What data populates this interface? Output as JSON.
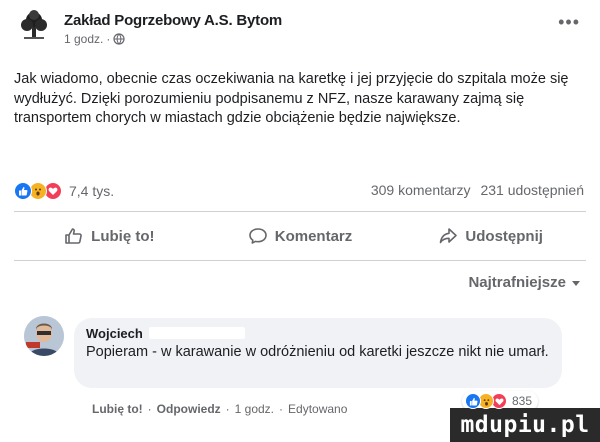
{
  "post": {
    "page_name": "Zakład Pogrzebowy A.S. Bytom",
    "time": "1 godz.",
    "separator": "·",
    "text": "Jak wiadomo, obecnie czas oczekiwania na karetkę i jej przyjęcie do szpitala może się wydłużyć. Dzięki porozumieniu podpisanemu z NFZ, nasze karawany zajmą się transportem chorych w miastach gdzie obciążenie będzie największe.",
    "more_icon": "more-horizontal-icon",
    "privacy_icon": "globe-icon"
  },
  "stats": {
    "reactions": "7,4 tys.",
    "comments": "309 komentarzy",
    "shares": "231 udostępnień",
    "reaction_icons": [
      "like-icon",
      "wow-icon",
      "love-icon"
    ]
  },
  "actions": {
    "like": "Lubię to!",
    "comment": "Komentarz",
    "share": "Udostępnij"
  },
  "comments_sort": "Najtrafniejsze",
  "comment": {
    "author": "Wojciech",
    "text": "Popieram - w karawanie w odróżnieniu od karetki jeszcze nikt nie umarł.",
    "reaction_count": "835",
    "like_label": "Lubię to!",
    "reply_label": "Odpowiedz",
    "time": "1 godz.",
    "edited": "Edytowano"
  },
  "watermark": "mdupiu.pl",
  "colors": {
    "facebook_blue": "#1877f2",
    "wow_yellow": "#f7b125",
    "love_red": "#f33e58",
    "secondary_text": "#65676b"
  }
}
